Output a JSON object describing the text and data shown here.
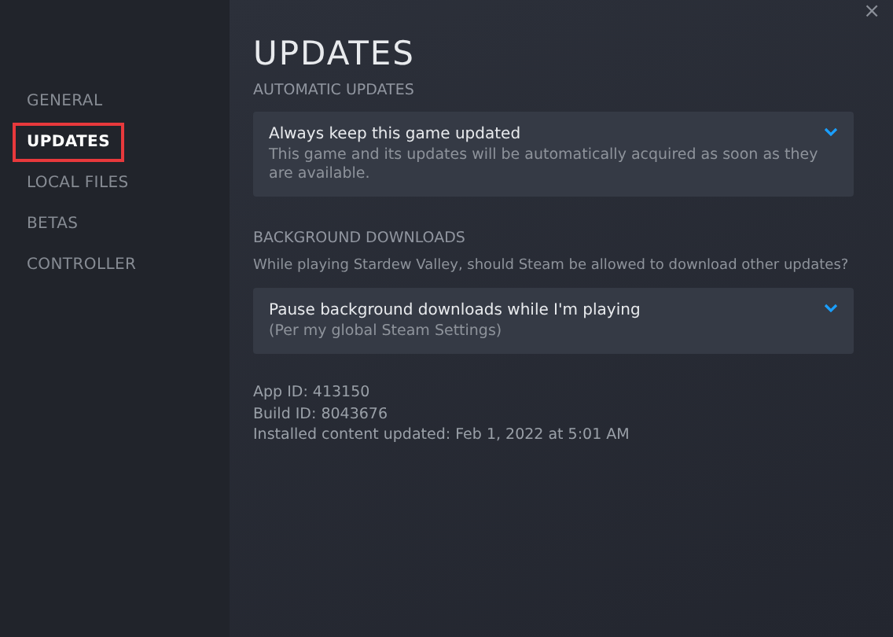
{
  "window": {
    "close": "×"
  },
  "sidebar": {
    "items": [
      {
        "label": "GENERAL",
        "selected": false
      },
      {
        "label": "UPDATES",
        "selected": true
      },
      {
        "label": "LOCAL FILES",
        "selected": false
      },
      {
        "label": "BETAS",
        "selected": false
      },
      {
        "label": "CONTROLLER",
        "selected": false
      }
    ]
  },
  "page": {
    "title": "UPDATES",
    "sections": [
      {
        "heading": "AUTOMATIC UPDATES",
        "dropdown": {
          "value": "Always keep this game updated",
          "description": "This game and its updates will be automatically acquired as soon as they are available."
        }
      },
      {
        "heading": "BACKGROUND DOWNLOADS",
        "question": "While playing Stardew Valley, should Steam be allowed to download other updates?",
        "dropdown": {
          "value": "Pause background downloads while I'm playing",
          "description": "(Per my global Steam Settings)"
        }
      }
    ],
    "info": [
      "App ID: 413150",
      "Build ID: 8043676",
      "Installed content updated: Feb 1, 2022 at 5:01 AM"
    ]
  }
}
